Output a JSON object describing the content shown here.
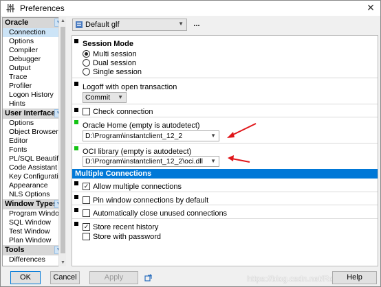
{
  "window": {
    "title": "Preferences",
    "close_glyph": "✕",
    "app_icon": "sliders-icon"
  },
  "sidebar": {
    "groups": [
      {
        "label": "Oracle",
        "items": [
          "Connection",
          "Options",
          "Compiler",
          "Debugger",
          "Output",
          "Trace",
          "Profiler",
          "Logon History",
          "Hints"
        ]
      },
      {
        "label": "User Interface",
        "items": [
          "Options",
          "Object Browser",
          "Editor",
          "Fonts",
          "PL/SQL Beautifier",
          "Code Assistant",
          "Key Configuration",
          "Appearance",
          "NLS Options"
        ]
      },
      {
        "label": "Window Types",
        "items": [
          "Program Window",
          "SQL Window",
          "Test Window",
          "Plan Window"
        ]
      },
      {
        "label": "Tools",
        "items": [
          "Differences"
        ]
      }
    ],
    "selected": "Connection",
    "chevron": "▼"
  },
  "profile": {
    "value": "Default glf",
    "more_label": "..."
  },
  "session_mode": {
    "title": "Session Mode",
    "options": [
      "Multi session",
      "Dual session",
      "Single session"
    ],
    "selected": "Multi session"
  },
  "logoff": {
    "label": "Logoff with open transaction",
    "value": "Commit"
  },
  "check_connection": {
    "label": "Check connection",
    "checked": false
  },
  "oracle_home": {
    "label": "Oracle Home (empty is autodetect)",
    "value": "D:\\Program\\instantclient_12_2"
  },
  "oci_library": {
    "label": "OCI library (empty is autodetect)",
    "value": "D:\\Program\\instantclient_12_2\\oci.dll"
  },
  "multiple_connections": {
    "header": "Multiple Connections",
    "allow": {
      "label": "Allow multiple connections",
      "checked": true
    },
    "pin": {
      "label": "Pin window connections by default",
      "checked": false
    },
    "auto_close": {
      "label": "Automatically close unused connections",
      "checked": false
    },
    "store_recent": {
      "label": "Store recent history",
      "checked": true
    },
    "store_password": {
      "label": "Store with password",
      "checked": false
    }
  },
  "buttons": {
    "ok": "OK",
    "cancel": "Cancel",
    "apply": "Apply",
    "help": "Help"
  },
  "watermark": "https://blog.csdn.net/Rohsto",
  "colors": {
    "accent": "#0078d7",
    "annotation_arrow": "#e0161a",
    "marker_green": "#14c314"
  }
}
